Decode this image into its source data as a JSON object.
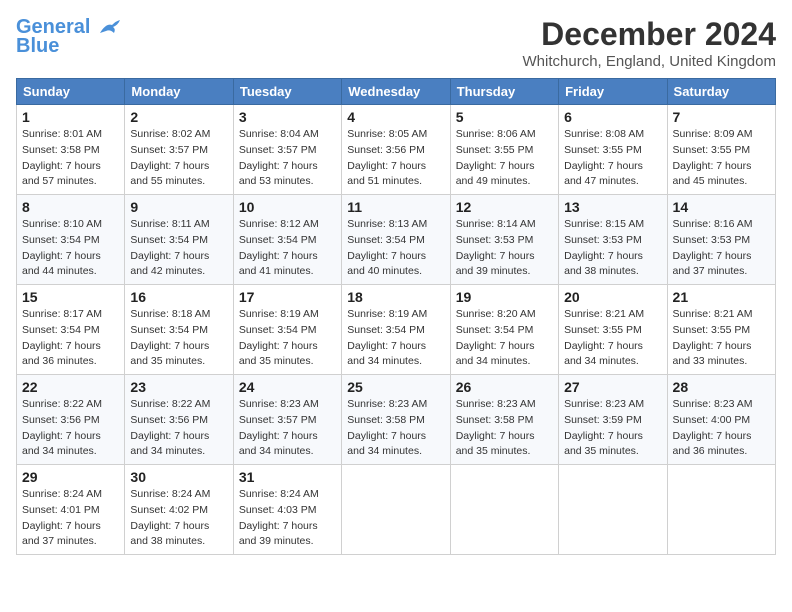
{
  "logo": {
    "line1": "General",
    "line2": "Blue"
  },
  "title": "December 2024",
  "subtitle": "Whitchurch, England, United Kingdom",
  "days_header": [
    "Sunday",
    "Monday",
    "Tuesday",
    "Wednesday",
    "Thursday",
    "Friday",
    "Saturday"
  ],
  "weeks": [
    [
      {
        "day": "1",
        "sunrise": "8:01 AM",
        "sunset": "3:58 PM",
        "daylight": "7 hours and 57 minutes."
      },
      {
        "day": "2",
        "sunrise": "8:02 AM",
        "sunset": "3:57 PM",
        "daylight": "7 hours and 55 minutes."
      },
      {
        "day": "3",
        "sunrise": "8:04 AM",
        "sunset": "3:57 PM",
        "daylight": "7 hours and 53 minutes."
      },
      {
        "day": "4",
        "sunrise": "8:05 AM",
        "sunset": "3:56 PM",
        "daylight": "7 hours and 51 minutes."
      },
      {
        "day": "5",
        "sunrise": "8:06 AM",
        "sunset": "3:55 PM",
        "daylight": "7 hours and 49 minutes."
      },
      {
        "day": "6",
        "sunrise": "8:08 AM",
        "sunset": "3:55 PM",
        "daylight": "7 hours and 47 minutes."
      },
      {
        "day": "7",
        "sunrise": "8:09 AM",
        "sunset": "3:55 PM",
        "daylight": "7 hours and 45 minutes."
      }
    ],
    [
      {
        "day": "8",
        "sunrise": "8:10 AM",
        "sunset": "3:54 PM",
        "daylight": "7 hours and 44 minutes."
      },
      {
        "day": "9",
        "sunrise": "8:11 AM",
        "sunset": "3:54 PM",
        "daylight": "7 hours and 42 minutes."
      },
      {
        "day": "10",
        "sunrise": "8:12 AM",
        "sunset": "3:54 PM",
        "daylight": "7 hours and 41 minutes."
      },
      {
        "day": "11",
        "sunrise": "8:13 AM",
        "sunset": "3:54 PM",
        "daylight": "7 hours and 40 minutes."
      },
      {
        "day": "12",
        "sunrise": "8:14 AM",
        "sunset": "3:53 PM",
        "daylight": "7 hours and 39 minutes."
      },
      {
        "day": "13",
        "sunrise": "8:15 AM",
        "sunset": "3:53 PM",
        "daylight": "7 hours and 38 minutes."
      },
      {
        "day": "14",
        "sunrise": "8:16 AM",
        "sunset": "3:53 PM",
        "daylight": "7 hours and 37 minutes."
      }
    ],
    [
      {
        "day": "15",
        "sunrise": "8:17 AM",
        "sunset": "3:54 PM",
        "daylight": "7 hours and 36 minutes."
      },
      {
        "day": "16",
        "sunrise": "8:18 AM",
        "sunset": "3:54 PM",
        "daylight": "7 hours and 35 minutes."
      },
      {
        "day": "17",
        "sunrise": "8:19 AM",
        "sunset": "3:54 PM",
        "daylight": "7 hours and 35 minutes."
      },
      {
        "day": "18",
        "sunrise": "8:19 AM",
        "sunset": "3:54 PM",
        "daylight": "7 hours and 34 minutes."
      },
      {
        "day": "19",
        "sunrise": "8:20 AM",
        "sunset": "3:54 PM",
        "daylight": "7 hours and 34 minutes."
      },
      {
        "day": "20",
        "sunrise": "8:21 AM",
        "sunset": "3:55 PM",
        "daylight": "7 hours and 34 minutes."
      },
      {
        "day": "21",
        "sunrise": "8:21 AM",
        "sunset": "3:55 PM",
        "daylight": "7 hours and 33 minutes."
      }
    ],
    [
      {
        "day": "22",
        "sunrise": "8:22 AM",
        "sunset": "3:56 PM",
        "daylight": "7 hours and 34 minutes."
      },
      {
        "day": "23",
        "sunrise": "8:22 AM",
        "sunset": "3:56 PM",
        "daylight": "7 hours and 34 minutes."
      },
      {
        "day": "24",
        "sunrise": "8:23 AM",
        "sunset": "3:57 PM",
        "daylight": "7 hours and 34 minutes."
      },
      {
        "day": "25",
        "sunrise": "8:23 AM",
        "sunset": "3:58 PM",
        "daylight": "7 hours and 34 minutes."
      },
      {
        "day": "26",
        "sunrise": "8:23 AM",
        "sunset": "3:58 PM",
        "daylight": "7 hours and 35 minutes."
      },
      {
        "day": "27",
        "sunrise": "8:23 AM",
        "sunset": "3:59 PM",
        "daylight": "7 hours and 35 minutes."
      },
      {
        "day": "28",
        "sunrise": "8:23 AM",
        "sunset": "4:00 PM",
        "daylight": "7 hours and 36 minutes."
      }
    ],
    [
      {
        "day": "29",
        "sunrise": "8:24 AM",
        "sunset": "4:01 PM",
        "daylight": "7 hours and 37 minutes."
      },
      {
        "day": "30",
        "sunrise": "8:24 AM",
        "sunset": "4:02 PM",
        "daylight": "7 hours and 38 minutes."
      },
      {
        "day": "31",
        "sunrise": "8:24 AM",
        "sunset": "4:03 PM",
        "daylight": "7 hours and 39 minutes."
      },
      null,
      null,
      null,
      null
    ]
  ]
}
